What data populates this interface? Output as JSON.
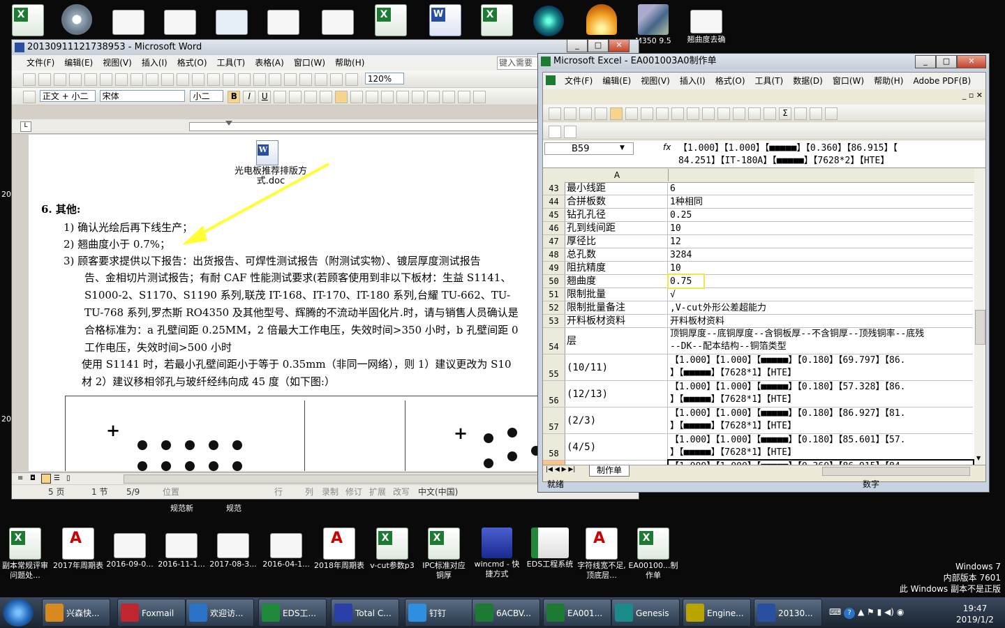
{
  "desktop_top_labels": [
    "M350 9.5",
    "翘曲度去确"
  ],
  "desktop_mid_labels": [
    "规范新",
    "规范"
  ],
  "desktop_bottom_icons": [
    {
      "label": "副本常规评审问题处..."
    },
    {
      "label": "2017年周期表"
    },
    {
      "label": "2016-09-0..."
    },
    {
      "label": "2016-11-1..."
    },
    {
      "label": "2017-08-3..."
    },
    {
      "label": "2016-04-1..."
    },
    {
      "label": "2018年周期表"
    },
    {
      "label": "v-cut参数p3"
    },
    {
      "label": "IPC标准对应铜厚"
    },
    {
      "label": "wincmd - 快捷方式"
    },
    {
      "label": "EDS工程系统"
    },
    {
      "label": "字符线宽不足,顶底层..."
    },
    {
      "label": "EA00100...制作单"
    }
  ],
  "os_watermark": {
    "line1": "Windows 7",
    "line2": "内部版本 7601",
    "line3": "此 Windows 副本不是正版"
  },
  "word": {
    "title": "20130911121738953 - Microsoft Word",
    "menu": [
      "文件(F)",
      "编辑(E)",
      "视图(V)",
      "插入(I)",
      "格式(O)",
      "工具(T)",
      "表格(A)",
      "窗口(W)",
      "帮助(H)"
    ],
    "help_box": "键入需要",
    "zoom": "120%",
    "style": "正文 + 小二",
    "font": "宋体",
    "size": "小二",
    "embedded_file": "光电板推荐排版方式.doc",
    "lines": [
      "6.   其他:",
      "1)  确认光绘后再下线生产；",
      "2)  翘曲度小于 0.7%；",
      "3)  顾客要求提供以下报告：出货报告、可焊性测试报告（附测试实物）、镀层厚度测试报告",
      "告、金相切片测试报告；有耐 CAF 性能测试要求(若顾客使用到非以下板材：生益 S1141、",
      "S1000-2、S1170、S1190 系列,联茂 IT-168、IT-170、IT-180 系列,台耀 TU-662、TU-",
      "TU-768 系列,罗杰斯  RO4350 及其他型号、辉腾的不流动半固化片.时，请与销售人员确认是",
      "合格标准为：a  孔壁间距 0.25MM，2 倍最大工作电压，失效时间>350 小时，b  孔壁间距 0",
      "工作电压，失效时间>500 小时",
      "使用 S1141 时，若最小孔壁间距小于等于 0.35mm（非同一网络），则 1）建议更改为 S10",
      "材        2）建议移相邻孔与玻纤经纬向成 45 度（如下图:）"
    ],
    "status": {
      "page": "5 页",
      "section": "1 节",
      "pages": "5/9",
      "position": "位置",
      "line": "行",
      "col": "列",
      "rec": "录制",
      "trk": "修订",
      "ext": "扩展",
      "ovr": "改写",
      "lang": "中文(中国)"
    }
  },
  "excel": {
    "title": "Microsoft Excel - EA001003A0制作单",
    "menu": [
      "文件(F)",
      "编辑(E)",
      "视图(V)",
      "插入(I)",
      "格式(O)",
      "工具(T)",
      "数据(D)",
      "窗口(W)",
      "帮助(H)",
      "Adobe PDF(B)"
    ],
    "namebox": "B59",
    "fx": "fx",
    "formula_line1": "【1.000】【1.000】【■■■■■】【0.360】【86.915】【",
    "formula_line2": "84.251】【IT-180A】【■■■■■】【7628*2】【HTE】",
    "col_header": "A",
    "rows": [
      {
        "n": "43",
        "a": "最小线距",
        "b": "6"
      },
      {
        "n": "44",
        "a": "合拼板数",
        "b": "1种相同"
      },
      {
        "n": "45",
        "a": "钻孔孔径",
        "b": "0.25"
      },
      {
        "n": "46",
        "a": "孔到线间距",
        "b": "10"
      },
      {
        "n": "47",
        "a": "厚径比",
        "b": "12"
      },
      {
        "n": "48",
        "a": "总孔数",
        "b": "3284"
      },
      {
        "n": "49",
        "a": "阻抗精度",
        "b": "10"
      },
      {
        "n": "50",
        "a": "翘曲度",
        "b": "0.75"
      },
      {
        "n": "51",
        "a": "限制批量",
        "b": "√"
      },
      {
        "n": "52",
        "a": "限制批量备注",
        "b": ",V-cut外形公差超能力"
      },
      {
        "n": "53",
        "a": "开料板材资料",
        "b": "开料板材资料"
      }
    ],
    "row54": {
      "n": "54",
      "a": "层",
      "b1": "顶铜厚度--底铜厚度--含铜板厚--不含铜厚--顶残铜率--底残",
      "b2": "--DK--配本结构--铜箔类型"
    },
    "tall_rows": [
      {
        "n": "55",
        "a": "(10/11)",
        "b1": "【1.000】【1.000】【■■■■■】【0.180】【69.797】【86.",
        "b2": "】【■■■■■】【7628*1】【HTE】"
      },
      {
        "n": "56",
        "a": "(12/13)",
        "b1": "【1.000】【1.000】【■■■■■】【0.180】【57.328】【86.",
        "b2": "】【■■■■■】【7628*1】【HTE】"
      },
      {
        "n": "57",
        "a": "(2/3)",
        "b1": "【1.000】【1.000】【■■■■■】【0.180】【86.927】【81.",
        "b2": "】【■■■■■】【7628*1】【HTE】"
      },
      {
        "n": "58",
        "a": "(4/5)",
        "b1": "【1.000】【1.000】【■■■■■】【0.180】【85.601】【57.",
        "b2": "】【■■■■■】【7628*1】【HTE】"
      },
      {
        "n": "59",
        "a": "(6/7)",
        "b1": "【1.000】【1.000】【■■■■■】【0.360】【86.915】【84.",
        "b2": ""
      }
    ],
    "sheet_tab": "制作单",
    "status_left": "就绪",
    "status_right": "数字"
  },
  "taskbar": {
    "items": [
      {
        "label": "兴森快...",
        "color": "#d98a1f"
      },
      {
        "label": "Foxmail",
        "color": "#c0262d"
      },
      {
        "label": "欢迎访...",
        "color": "#2a73c8"
      },
      {
        "label": "EDS工...",
        "color": "#1e8a3a"
      },
      {
        "label": "Total C...",
        "color": "#2a3fa8"
      },
      {
        "label": "钉钉",
        "color": "#2e8fe0"
      },
      {
        "label": "6ACBV...",
        "color": "#1d7a33"
      },
      {
        "label": "EA001...",
        "color": "#1d7a33"
      },
      {
        "label": "Genesis",
        "color": "#1a8a8a"
      },
      {
        "label": "Engine...",
        "color": "#bba400"
      },
      {
        "label": "20130...",
        "color": "#2a4fa0"
      }
    ],
    "time": "19:47",
    "date": "2019/1/2"
  }
}
